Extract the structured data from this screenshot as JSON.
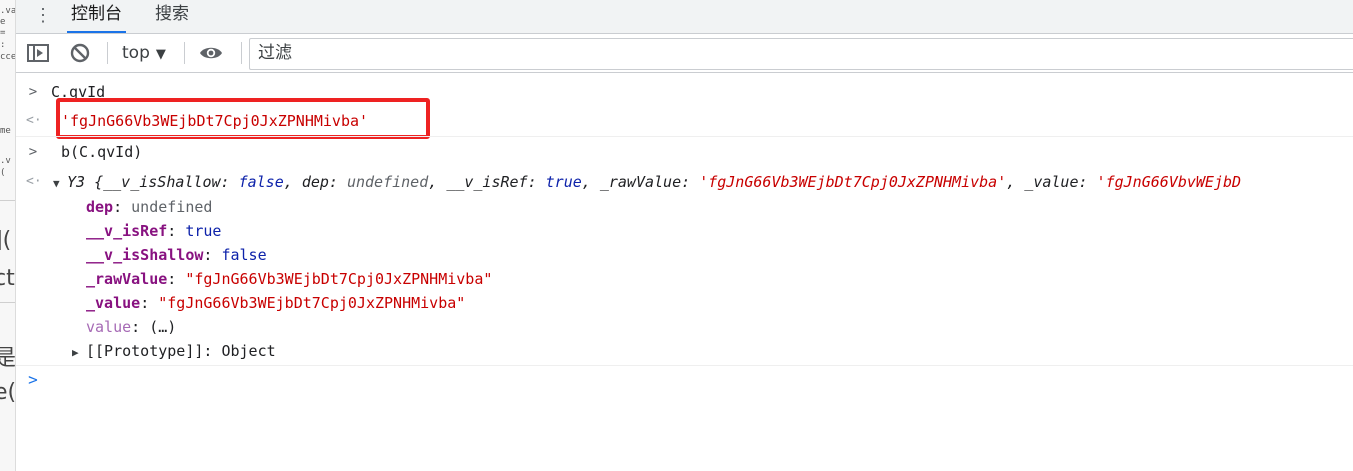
{
  "tabs": {
    "menu_icon": "kebab-menu-icon",
    "items": [
      {
        "label": "控制台",
        "active": true
      },
      {
        "label": "搜索",
        "active": false
      }
    ]
  },
  "toolbar": {
    "sidebar_icon": "sidebar-toggle-icon",
    "clear_icon": "clear-console-icon",
    "context": "top",
    "eye_icon": "eye-icon",
    "filter_placeholder": "过滤"
  },
  "console": {
    "input1": "C.qvId",
    "result1": "'fgJnG66Vb3WEjbDt7Cpj0JxZPNHMivba'",
    "input2": "b(C.qvId)",
    "object_summary": {
      "class_name": "Y3",
      "open": "{",
      "k1": "__v_isShallow",
      "v1": "false",
      "k2": "dep",
      "v2": "undefined",
      "k3": "__v_isRef",
      "v3": "true",
      "k4": "_rawValue",
      "v4": "'fgJnG66Vb3WEjbDt7Cpj0JxZPNHMivba'",
      "k5": "_value",
      "v5": "'fgJnG66VbvWEjbD"
    },
    "props": [
      {
        "key": "dep",
        "value": "undefined"
      },
      {
        "key": "__v_isRef",
        "value": "true"
      },
      {
        "key": "__v_isShallow",
        "value": "false"
      },
      {
        "key": "_rawValue",
        "value": "\"fgJnG66Vb3WEjbDt7Cpj0JxZPNHMivba\""
      },
      {
        "key": "_value",
        "value": "\"fgJnG66Vb3WEjbDt7Cpj0JxZPNHMivba\""
      },
      {
        "key": "value",
        "value": "(…)"
      }
    ],
    "prototype": {
      "key": "[[Prototype]]",
      "value": "Object"
    }
  },
  "colors": {
    "accent": "#1a73e8",
    "highlight": "#ee2222",
    "string": "#c80000",
    "keyword": "#0d22aa",
    "property": "#881280"
  }
}
